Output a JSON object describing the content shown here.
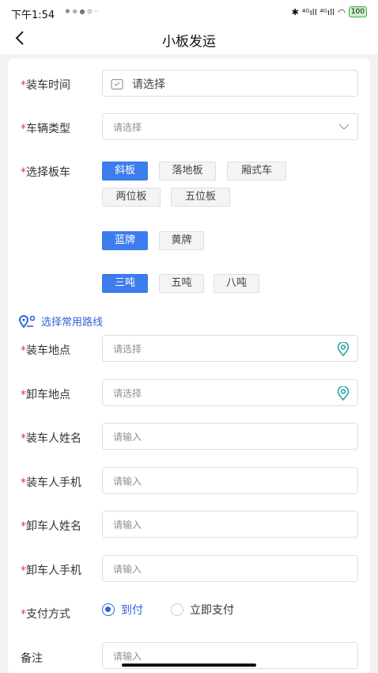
{
  "status_bar": {
    "time": "下午1:54",
    "small_icons": "✱ ⊕ ● ⊙ ··",
    "network": "⁴ᴳıll ⁴ᴳıll",
    "battery": "100"
  },
  "nav": {
    "title": "小板发运"
  },
  "form": {
    "load_time": {
      "label": "装车时间",
      "placeholder": "请选择"
    },
    "vehicle_type": {
      "label": "车辆类型",
      "placeholder": "请选择"
    },
    "trailer": {
      "label": "选择板车",
      "options": [
        "斜板",
        "落地板",
        "厢式车",
        "两位板",
        "五位板"
      ],
      "selected": "斜板"
    },
    "plate": {
      "options": [
        "蓝牌",
        "黄牌"
      ],
      "selected": "蓝牌"
    },
    "tonnage": {
      "options": [
        "三吨",
        "五吨",
        "八吨"
      ],
      "selected": "三吨"
    },
    "route_link": "选择常用路线",
    "load_place": {
      "label": "装车地点",
      "placeholder": "请选择"
    },
    "unload_place": {
      "label": "卸车地点",
      "placeholder": "请选择"
    },
    "loader_name": {
      "label": "装车人姓名",
      "placeholder": "请输入"
    },
    "loader_phone": {
      "label": "装车人手机",
      "placeholder": "请输入"
    },
    "unloader_name": {
      "label": "卸车人姓名",
      "placeholder": "请输入"
    },
    "unloader_phone": {
      "label": "卸车人手机",
      "placeholder": "请输入"
    },
    "payment": {
      "label": "支付方式",
      "options": [
        "到付",
        "立即支付"
      ],
      "selected": "到付"
    },
    "remark": {
      "label": "备注",
      "placeholder": "请输入"
    },
    "required_mark": "*"
  },
  "colors": {
    "accent": "#3c7cec",
    "required": "#e33333",
    "link": "#2f63d8"
  }
}
